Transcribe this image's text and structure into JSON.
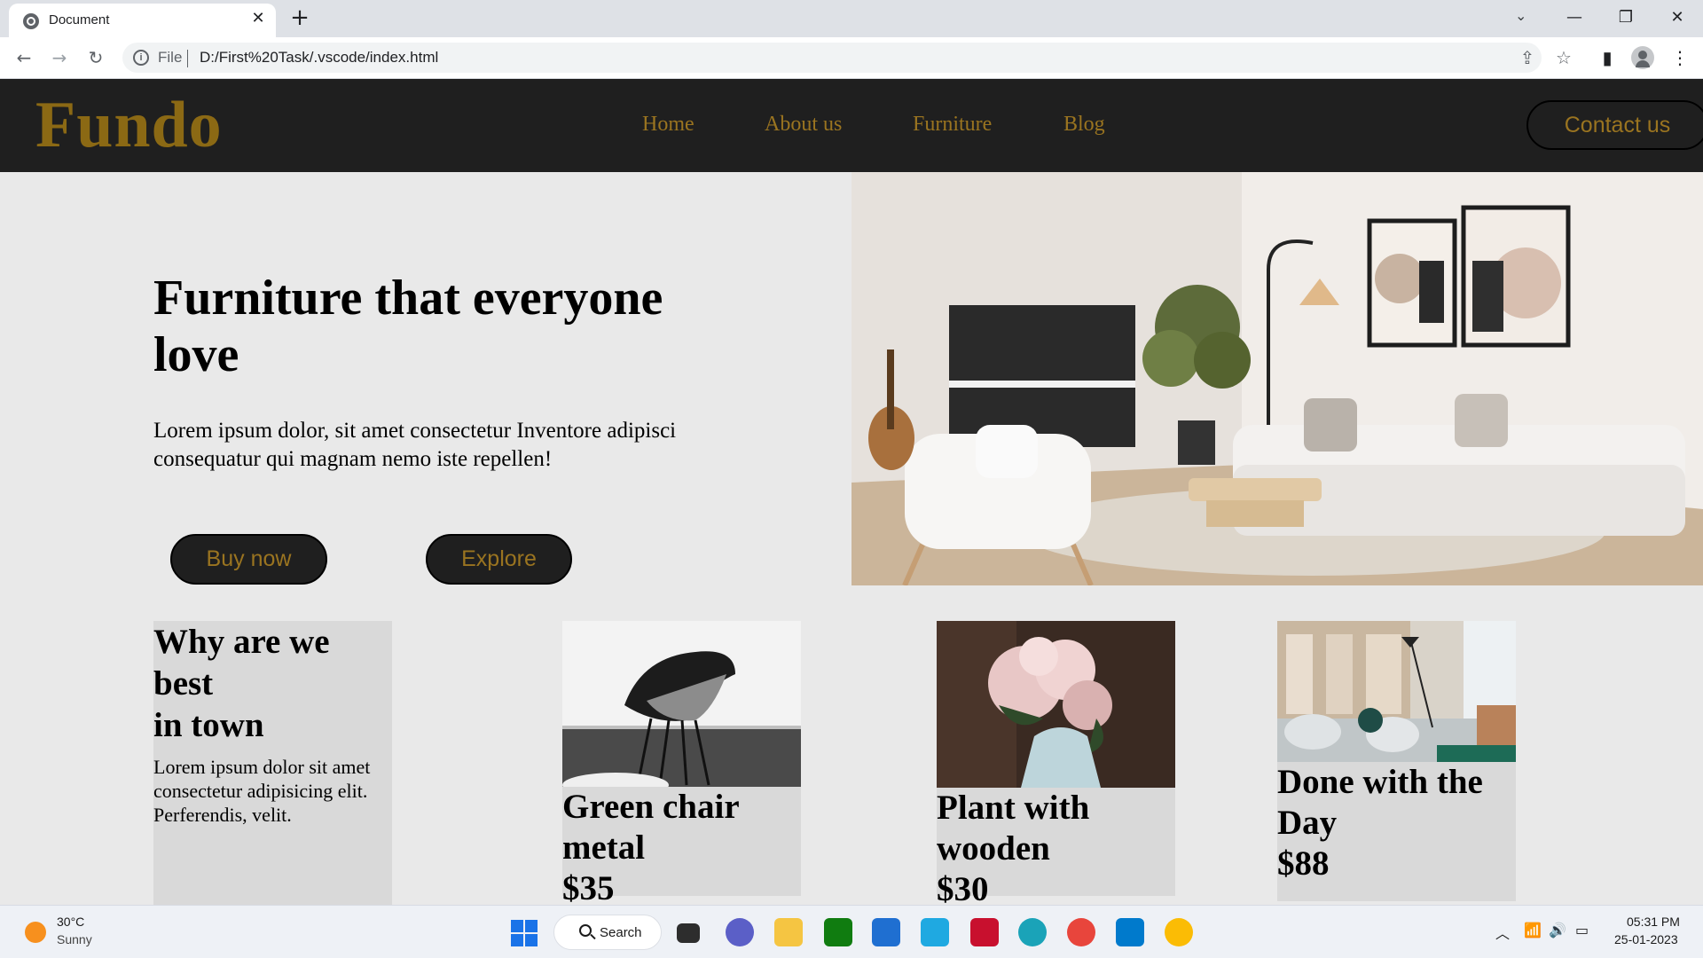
{
  "browser": {
    "tab_title": "Document",
    "tab_close": "✕",
    "new_tab": "+",
    "tab_list": "⌄",
    "minimize": "—",
    "restore": "❐",
    "close": "✕",
    "back": "←",
    "forward": "→",
    "reload": "↻",
    "info": "i",
    "scheme_label": "File",
    "url": "D:/First%20Task/.vscode/index.html",
    "share": "⇪",
    "bookmark": "☆",
    "side_panel": "▮",
    "menu": "⋮"
  },
  "site": {
    "logo": "Fundo",
    "nav": [
      "Home",
      "About us",
      "Furniture",
      "Blog"
    ],
    "contact": "Contact us",
    "brand_color": "#8b6914",
    "nav_bg": "#1f1f1f"
  },
  "hero": {
    "title": "Furniture that everyone love",
    "text": "Lorem ipsum dolor, sit amet consectetur Inventore adipisci consequatur qui magnam nemo iste repellen!",
    "buy_label": "Buy now",
    "explore_label": "Explore"
  },
  "why": {
    "title_line1": "Why are we best",
    "title_line2": "in town",
    "text": "Lorem ipsum dolor sit amet consectetur adipisicing elit. Perferendis, velit."
  },
  "products": [
    {
      "title": "Green chair metal",
      "price": "$35"
    },
    {
      "title": "Plant with wooden",
      "price": "$30"
    },
    {
      "title": "Done with the Day",
      "price": "$88"
    }
  ],
  "taskbar": {
    "temp": "30°C",
    "condition": "Sunny",
    "search": "Search",
    "tray_chevron": "︿",
    "wifi": "📶",
    "volume": "🔊",
    "battery": "▭",
    "time": "05:31 PM",
    "date": "25-01-2023"
  }
}
